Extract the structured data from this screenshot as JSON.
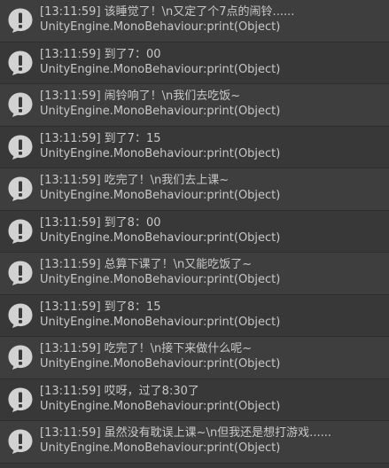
{
  "console": {
    "entries": [
      {
        "time": "[13:11:59]",
        "message": "该睡觉了！\\n又定了个7点的闹铃......",
        "source": "UnityEngine.MonoBehaviour:print(Object)"
      },
      {
        "time": "[13:11:59]",
        "message": "到了7：00",
        "source": "UnityEngine.MonoBehaviour:print(Object)"
      },
      {
        "time": "[13:11:59]",
        "message": "闹铃响了！\\n我们去吃饭~",
        "source": "UnityEngine.MonoBehaviour:print(Object)"
      },
      {
        "time": "[13:11:59]",
        "message": "到了7：15",
        "source": "UnityEngine.MonoBehaviour:print(Object)"
      },
      {
        "time": "[13:11:59]",
        "message": "吃完了！\\n我们去上课~",
        "source": "UnityEngine.MonoBehaviour:print(Object)"
      },
      {
        "time": "[13:11:59]",
        "message": "到了8：00",
        "source": "UnityEngine.MonoBehaviour:print(Object)"
      },
      {
        "time": "[13:11:59]",
        "message": "总算下课了！\\n又能吃饭了~",
        "source": "UnityEngine.MonoBehaviour:print(Object)"
      },
      {
        "time": "[13:11:59]",
        "message": "到了8：15",
        "source": "UnityEngine.MonoBehaviour:print(Object)"
      },
      {
        "time": "[13:11:59]",
        "message": "吃完了！\\n接下来做什么呢~",
        "source": "UnityEngine.MonoBehaviour:print(Object)"
      },
      {
        "time": "[13:11:59]",
        "message": "哎呀，过了8:30了",
        "source": "UnityEngine.MonoBehaviour:print(Object)"
      },
      {
        "time": "[13:11:59]",
        "message": "虽然没有耽误上课~\\n但我还是想打游戏......",
        "source": "UnityEngine.MonoBehaviour:print(Object)"
      }
    ],
    "icon": "info-speech-bubble-icon",
    "colors": {
      "background": "#383838",
      "row_alt": "#3e3e3e",
      "text": "#c8c8c8",
      "icon": "#d2d2d2"
    }
  }
}
